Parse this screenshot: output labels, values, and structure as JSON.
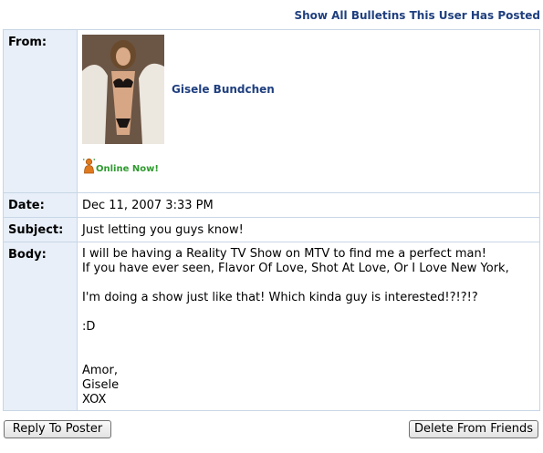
{
  "header": {
    "show_all_link": "Show All Bulletins This User Has Posted"
  },
  "bulletin": {
    "from_label": "From:",
    "sender_name": "Gisele Bundchen",
    "online_status": "Online Now!",
    "date_label": "Date:",
    "date_value": "Dec 11, 2007 3:33 PM",
    "subject_label": "Subject:",
    "subject_value": "Just letting you guys know!",
    "body_label": "Body:",
    "body_text": "I will be having a Reality TV Show on MTV to find me a perfect man!\nIf you have ever seen, Flavor Of Love, Shot At Love, Or I Love New York,\n\nI'm doing a show just like that! Which kinda guy is interested!?!?!?\n\n:D\n\n\nAmor,\nGisele\nXOX"
  },
  "buttons": {
    "reply_label": "Reply To Poster",
    "delete_label": "Delete From Friends"
  },
  "colors": {
    "link": "#1f3f7f",
    "label_bg": "#e8eff8",
    "border": "#c8d6e6",
    "online_green": "#2e9a2e",
    "online_icon": "#e07a1f"
  },
  "icons": {
    "online": "person-online-icon"
  }
}
